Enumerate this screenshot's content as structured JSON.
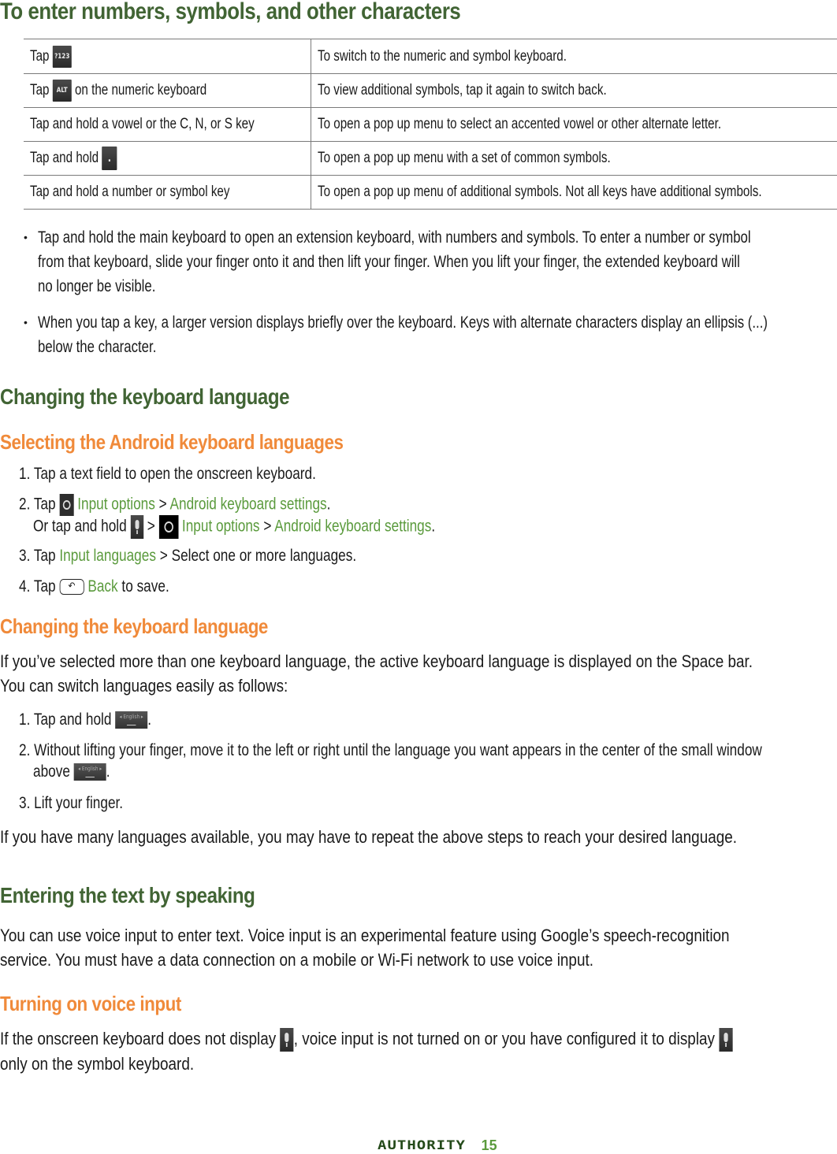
{
  "section_numbers": {
    "title": "To enter numbers, symbols, and other characters",
    "table": [
      {
        "action_prefix": "Tap",
        "icon": "?123",
        "icon_name": "numeric-key-icon",
        "action_suffix": "",
        "result": "To switch to the numeric and symbol keyboard."
      },
      {
        "action_prefix": "Tap",
        "icon": "ALT",
        "icon_name": "alt-key-icon",
        "action_suffix": "on the numeric keyboard",
        "result": "To view additional symbols, tap it again to switch back."
      },
      {
        "action_prefix": "Tap and hold a vowel or the C, N, or S key",
        "icon": "",
        "icon_name": "",
        "action_suffix": "",
        "result": "To open a pop up menu to select an accented vowel or other alternate letter."
      },
      {
        "action_prefix": "Tap and hold",
        "icon": ".",
        "icon_name": "period-key-icon",
        "action_suffix": "",
        "result": "To open a pop up menu with a set of common symbols."
      },
      {
        "action_prefix": "Tap and hold a number or symbol key",
        "icon": "",
        "icon_name": "",
        "action_suffix": "",
        "result": "To open a pop up menu of additional symbols. Not all keys have additional symbols."
      }
    ],
    "bullets": [
      [
        "Tap and hold the main keyboard to open an extension keyboard, with numbers and symbols. To enter a number or symbol",
        "from that keyboard, slide your finger onto it and then lift your finger. When you lift your finger, the extended keyboard will",
        "no longer be visible."
      ],
      [
        "When you tap a key, a larger version displays briefly over the keyboard. Keys with alternate characters display an ellipsis (...)",
        "below the character."
      ]
    ]
  },
  "section_language": {
    "title": "Changing the keyboard language",
    "sub1": {
      "title": "Selecting the Android keyboard languages",
      "step1": "1. Tap a text field to open the onscreen keyboard.",
      "step2_prefix": "2. Tap",
      "step2_link1": "Input options",
      "step2_sep": ">",
      "step2_link2": "Android keyboard settings",
      "step2_end": ".",
      "step2b_prefix": "Or tap and hold",
      "step3_prefix": "3. Tap",
      "step3_link": "Input languages",
      "step3_rest": "> Select one or more languages.",
      "step4_prefix": "4. Tap",
      "step4_icon": "↶",
      "step4_link": "Back",
      "step4_rest": "to save."
    },
    "sub2": {
      "title": "Changing the keyboard language",
      "para1": "If you’ve selected more than one keyboard language, the active keyboard language is displayed on the Space bar.",
      "para2": "You can switch languages easily as follows:",
      "step1_prefix": "1. Tap and hold",
      "space_key_label": "◂ English ▸",
      "step2_line1": "2. Without lifting your finger, move it to the left or right until the language you want appears in the center of the small window",
      "step2_line2_prefix": "above",
      "step3": "3. Lift your finger.",
      "para3": "If you have many languages available, you may have to repeat the above steps to reach your desired language."
    }
  },
  "section_voice": {
    "title": "Entering the text by speaking",
    "para1": "You can use voice input to enter text. Voice input is an experimental feature using Google’s speech-recognition",
    "para2": "service. You must have a data connection on a mobile or Wi-Fi network to use voice input.",
    "sub_title": "Turning on voice input",
    "para3_a": "If the onscreen keyboard does not display",
    "para3_b": ", voice input is not turned on or you have configured it to display",
    "para3_c": "only on the symbol keyboard."
  },
  "footer": {
    "brand": "AUTHORITY",
    "page": "15"
  },
  "colors": {
    "heading_green": "#416434",
    "heading_orange": "#f08a3a",
    "link_green": "#5a9a3c"
  }
}
